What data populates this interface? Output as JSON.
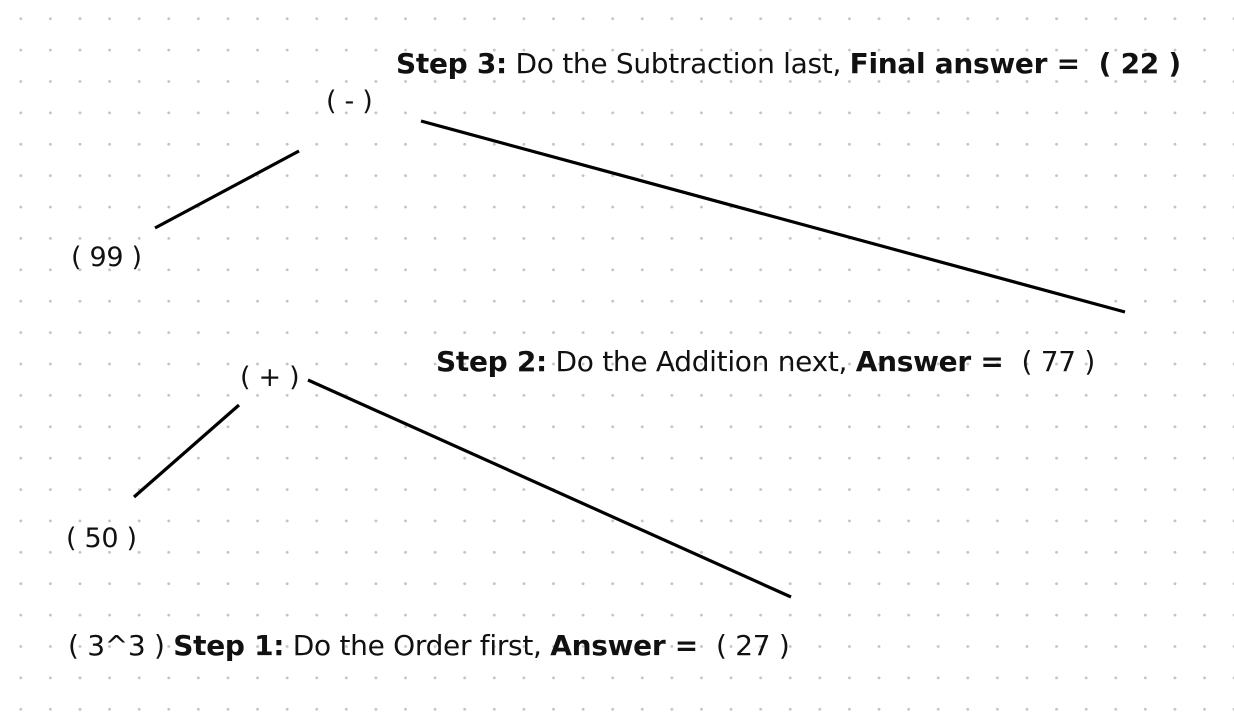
{
  "nodes": {
    "minus": "( - )",
    "left_99": "( 99 )",
    "plus": "( + )",
    "left_50": "( 50 )",
    "power": "( 3^3 )"
  },
  "steps": {
    "step3": {
      "label": "Step 3:",
      "text": " Do the Subtraction last, ",
      "answer_label": "Final answer = ",
      "answer_value": " ( 22 )"
    },
    "step2": {
      "label": "Step 2:",
      "text": " Do the Addition next, ",
      "answer_label": "Answer = ",
      "answer_value": " ( 77 )"
    },
    "step1": {
      "label": "Step 1:",
      "text": " Do the Order first, ",
      "answer_label": "Answer = ",
      "answer_value": " ( 27 )"
    }
  },
  "colors": {
    "line": "#000000",
    "text": "#111111",
    "grid_dot": "#c4c4c4",
    "background": "#ffffff"
  }
}
